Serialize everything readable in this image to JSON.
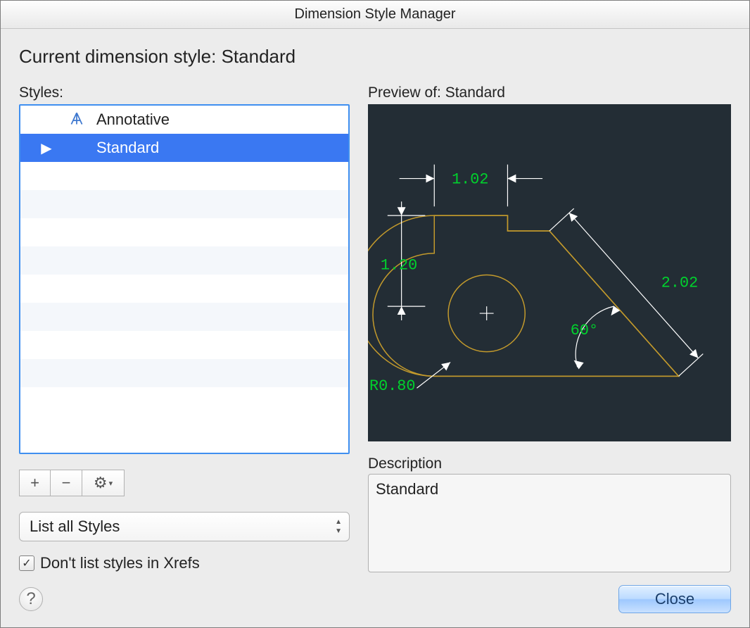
{
  "window": {
    "title": "Dimension Style Manager"
  },
  "header": {
    "current_label": "Current dimension style:",
    "current_value": "Standard"
  },
  "left": {
    "styles_label": "Styles:",
    "styles": [
      {
        "name": "Annotative",
        "annotative": true,
        "selected": false,
        "marker": ""
      },
      {
        "name": "Standard",
        "annotative": false,
        "selected": true,
        "marker": "▶"
      }
    ],
    "toolbar": {
      "add": "+",
      "remove": "−",
      "gear": "⚙",
      "gear_chev": "▾"
    },
    "filter_selected": "List all Styles",
    "xrefs_checkbox": {
      "checked": true,
      "label": "Don't list styles in Xrefs"
    }
  },
  "right": {
    "preview_label_prefix": "Preview of:",
    "preview_style_name": "Standard",
    "dimensions": {
      "top": "1.02",
      "left": "1.20",
      "diag": "2.02",
      "angle": "60°",
      "radius": "R0.80"
    },
    "description_label": "Description",
    "description_value": "Standard"
  },
  "footer": {
    "help": "?",
    "close": "Close"
  }
}
